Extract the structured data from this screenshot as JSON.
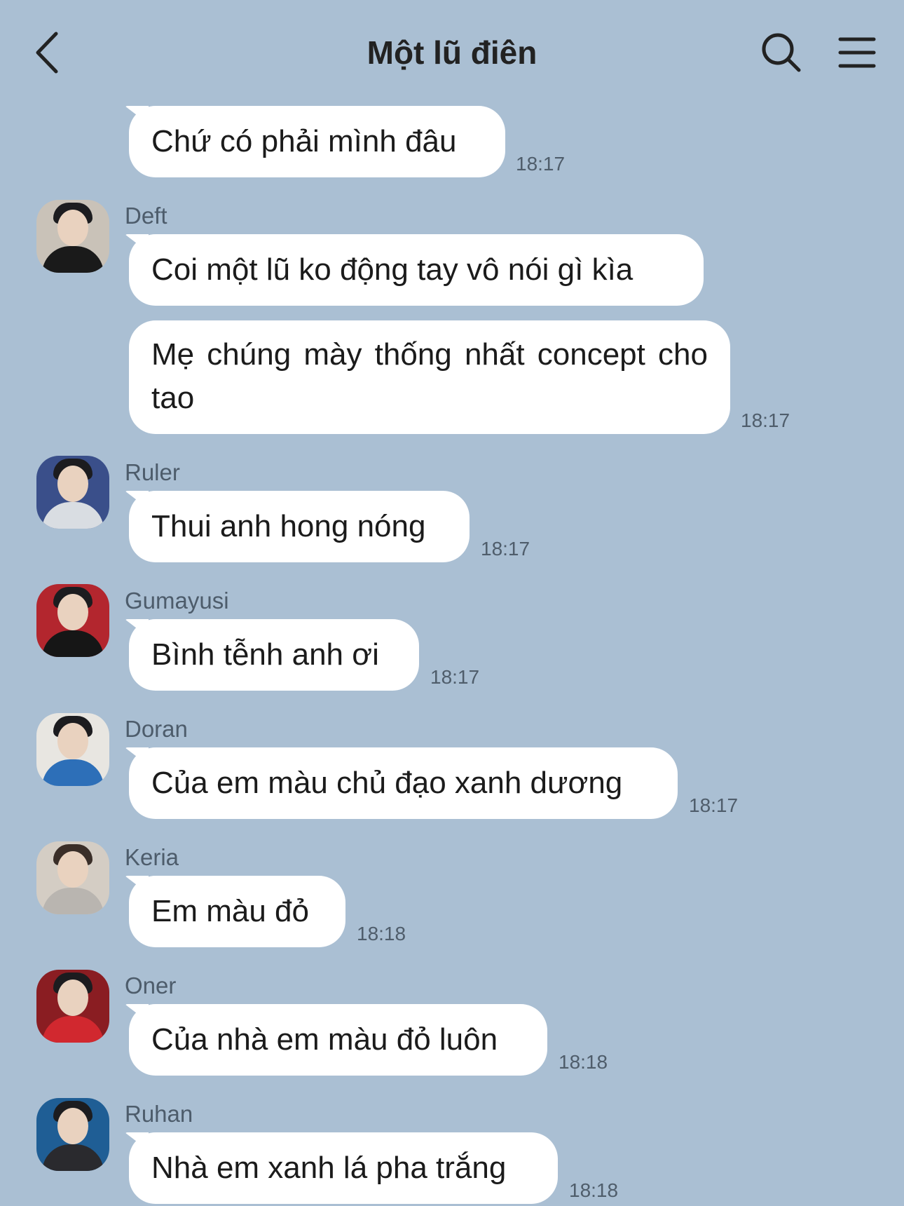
{
  "header": {
    "title": "Một lũ điên",
    "back_icon": "chevron-left-icon",
    "search_icon": "search-icon",
    "menu_icon": "hamburger-menu-icon"
  },
  "messages": [
    {
      "sender": "",
      "text": "Chứ có phải mình đâu",
      "time": "18:17"
    },
    {
      "sender": "Deft",
      "text": "Coi một lũ ko động tay vô nói gì kìa",
      "time": ""
    },
    {
      "sender": "",
      "text": "Mẹ chúng mày thống nhất concept cho tao",
      "time": "18:17"
    },
    {
      "sender": "Ruler",
      "text": "Thui anh hong nóng",
      "time": "18:17"
    },
    {
      "sender": "Gumayusi",
      "text": "Bình tễnh anh ơi",
      "time": "18:17"
    },
    {
      "sender": "Doran",
      "text": "Của em màu chủ đạo xanh dương",
      "time": "18:17"
    },
    {
      "sender": "Keria",
      "text": "Em màu đỏ",
      "time": "18:18"
    },
    {
      "sender": "Oner",
      "text": "Của nhà em màu đỏ luôn",
      "time": "18:18"
    },
    {
      "sender": "Ruhan",
      "text": "Nhà em xanh lá pha trắng",
      "time": "18:18"
    }
  ],
  "colors": {
    "background": "#aabfd3",
    "bubble": "#ffffff",
    "text": "#1b1b1b",
    "meta": "#4f5d6b"
  }
}
